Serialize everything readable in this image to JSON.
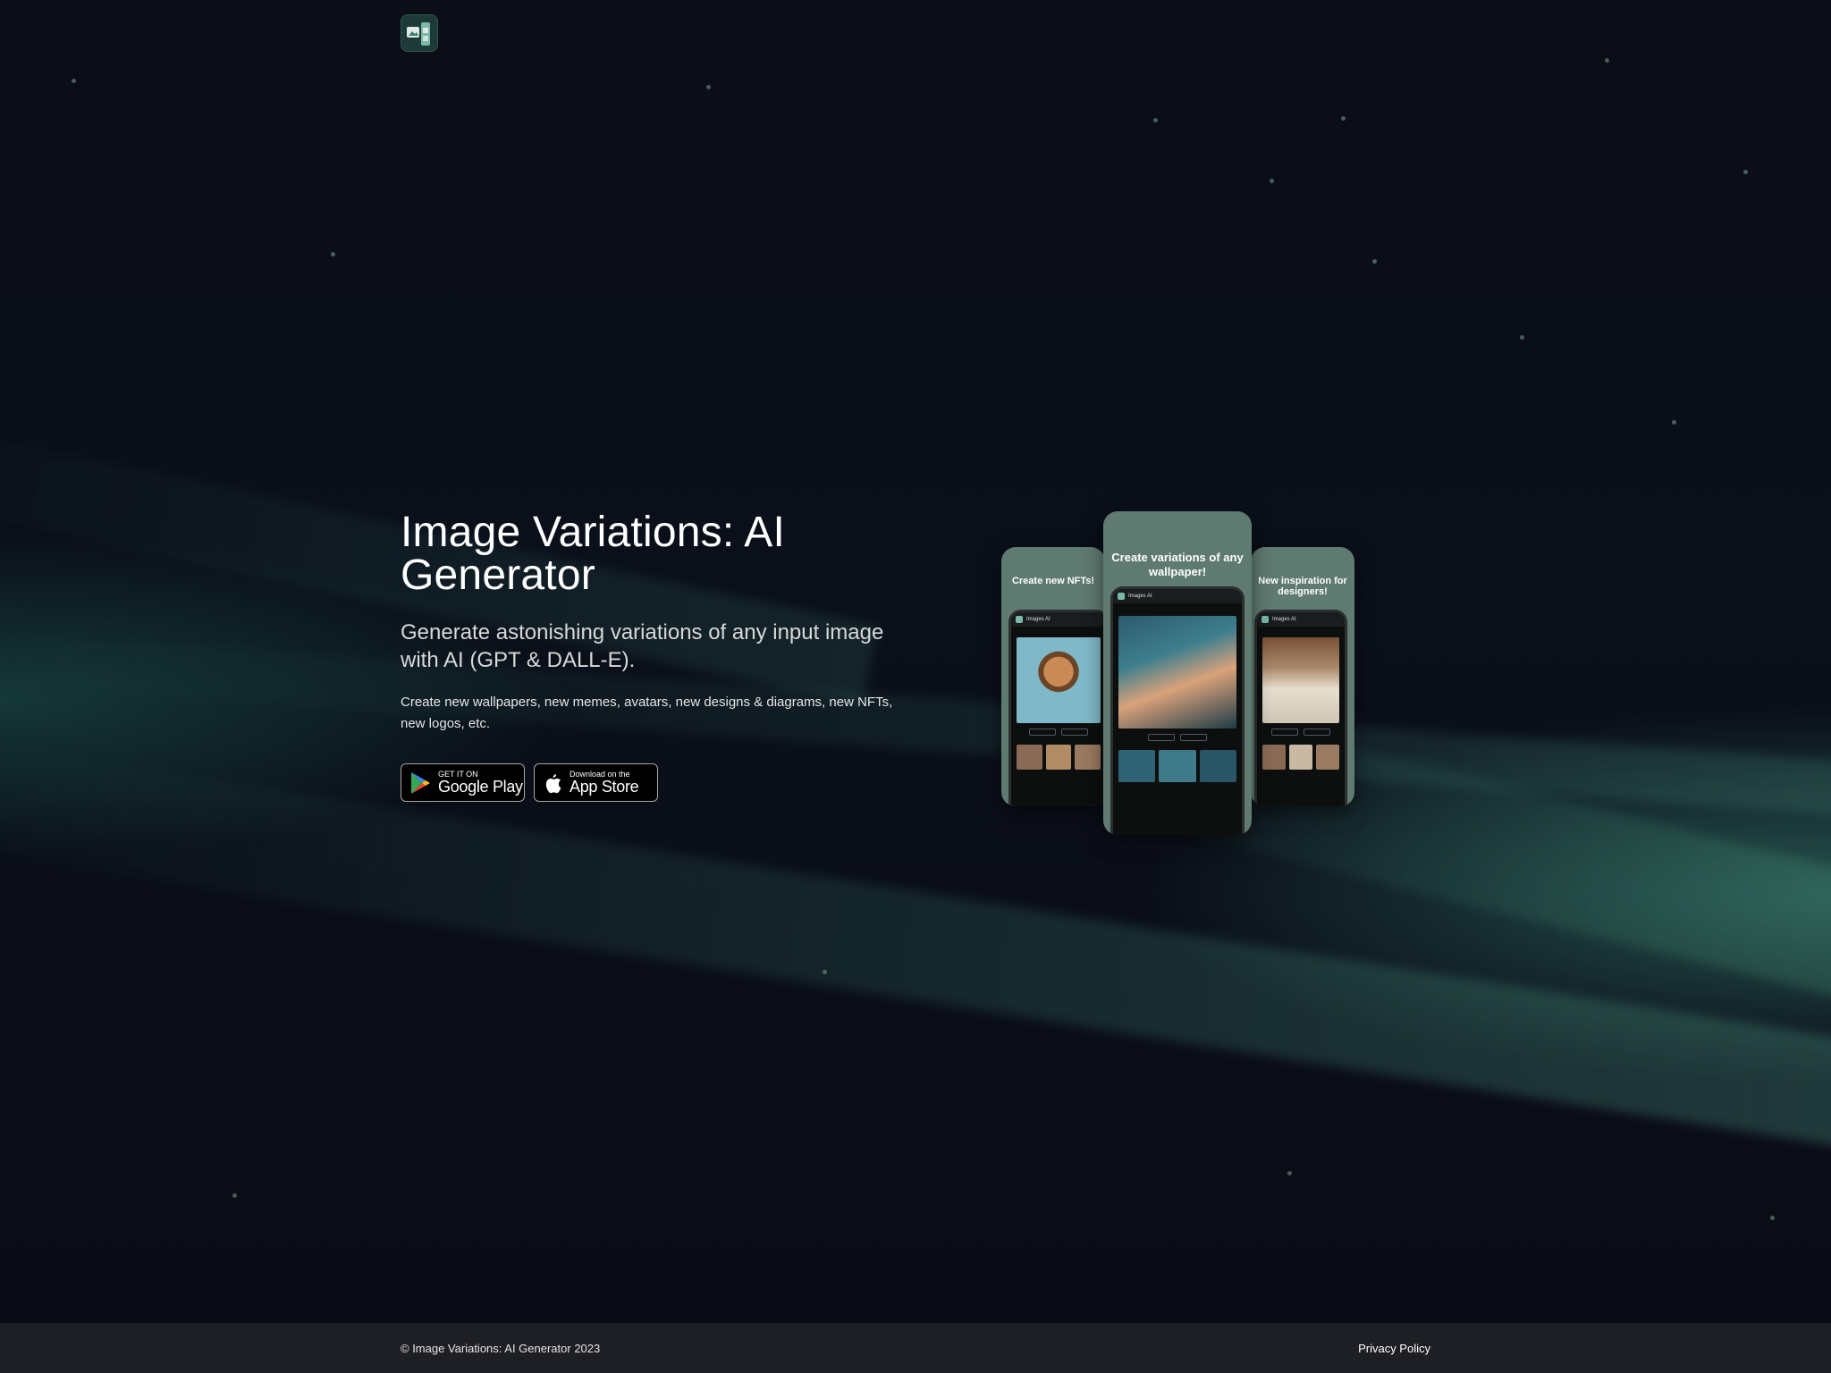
{
  "logo": {
    "icon": "app-logo-icon"
  },
  "hero": {
    "title": "Image Variations: AI Generator",
    "subtitle": "Generate astonishing variations of any input image with AI (GPT & DALL-E).",
    "description": "Create new wallpapers, new memes, avatars, new designs & diagrams, new NFTs, new logos, etc."
  },
  "stores": {
    "google_play": {
      "small": "GET IT ON",
      "big": "Google Play",
      "icon": "google-play-icon"
    },
    "app_store": {
      "small": "Download on the",
      "big": "App Store",
      "icon": "apple-icon"
    }
  },
  "phones": {
    "left_caption": "Create new NFTs!",
    "middle_caption": "Create variations of any wallpaper!",
    "right_caption": "New inspiration for designers!",
    "app_name": "Images AI"
  },
  "footer": {
    "copyright": "© Image Variations: AI Generator 2023",
    "privacy_link": "Privacy Policy"
  },
  "colors": {
    "background": "#0a0a14",
    "accent_teal": "#5f7a70",
    "footer_bg": "#1e1f24"
  }
}
